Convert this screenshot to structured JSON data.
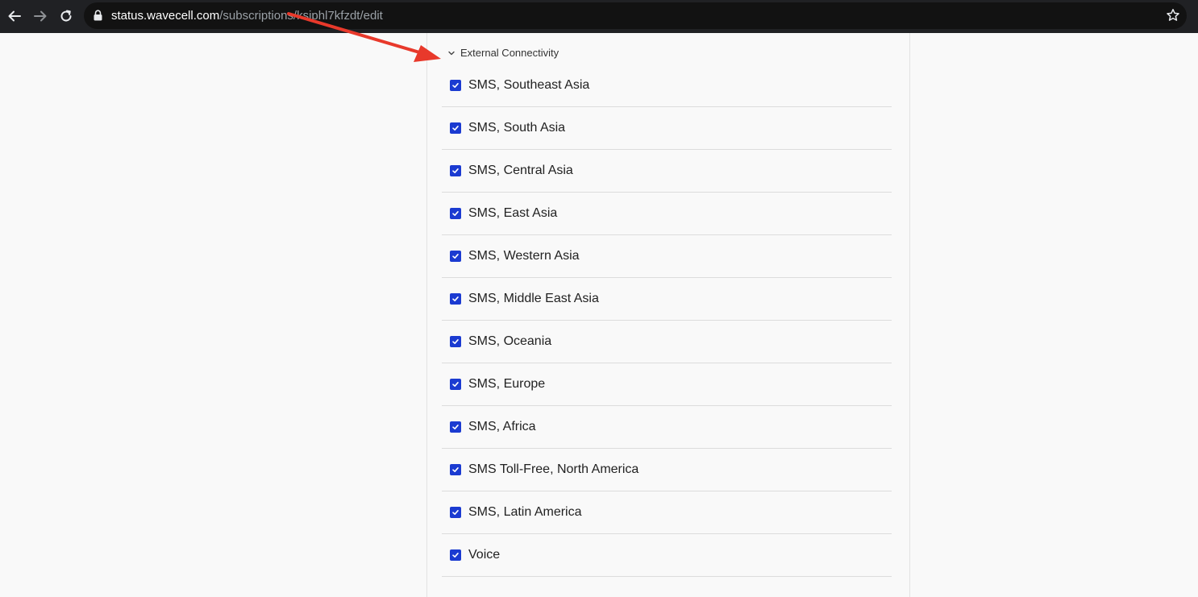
{
  "browser": {
    "url_host": "status.wavecell.com",
    "url_path": "/subscriptions/ksiphl7kfzdt/edit",
    "icons": [
      "back-arrow-icon",
      "forward-arrow-icon",
      "reload-icon",
      "lock-icon",
      "star-icon"
    ]
  },
  "group": {
    "label": "External Connectivity",
    "expanded": true,
    "items": [
      {
        "label": "SMS, Southeast Asia",
        "checked": true
      },
      {
        "label": "SMS, South Asia",
        "checked": true
      },
      {
        "label": "SMS, Central Asia",
        "checked": true
      },
      {
        "label": "SMS, East Asia",
        "checked": true
      },
      {
        "label": "SMS, Western Asia",
        "checked": true
      },
      {
        "label": "SMS, Middle East Asia",
        "checked": true
      },
      {
        "label": "SMS, Oceania",
        "checked": true
      },
      {
        "label": "SMS, Europe",
        "checked": true
      },
      {
        "label": "SMS, Africa",
        "checked": true
      },
      {
        "label": "SMS Toll-Free, North America",
        "checked": true
      },
      {
        "label": "SMS, Latin America",
        "checked": true
      },
      {
        "label": "Voice",
        "checked": true
      }
    ]
  },
  "colors": {
    "checkbox": "#1b3bd1",
    "annotation_arrow": "#e8392b",
    "browser_bar": "#202124"
  }
}
